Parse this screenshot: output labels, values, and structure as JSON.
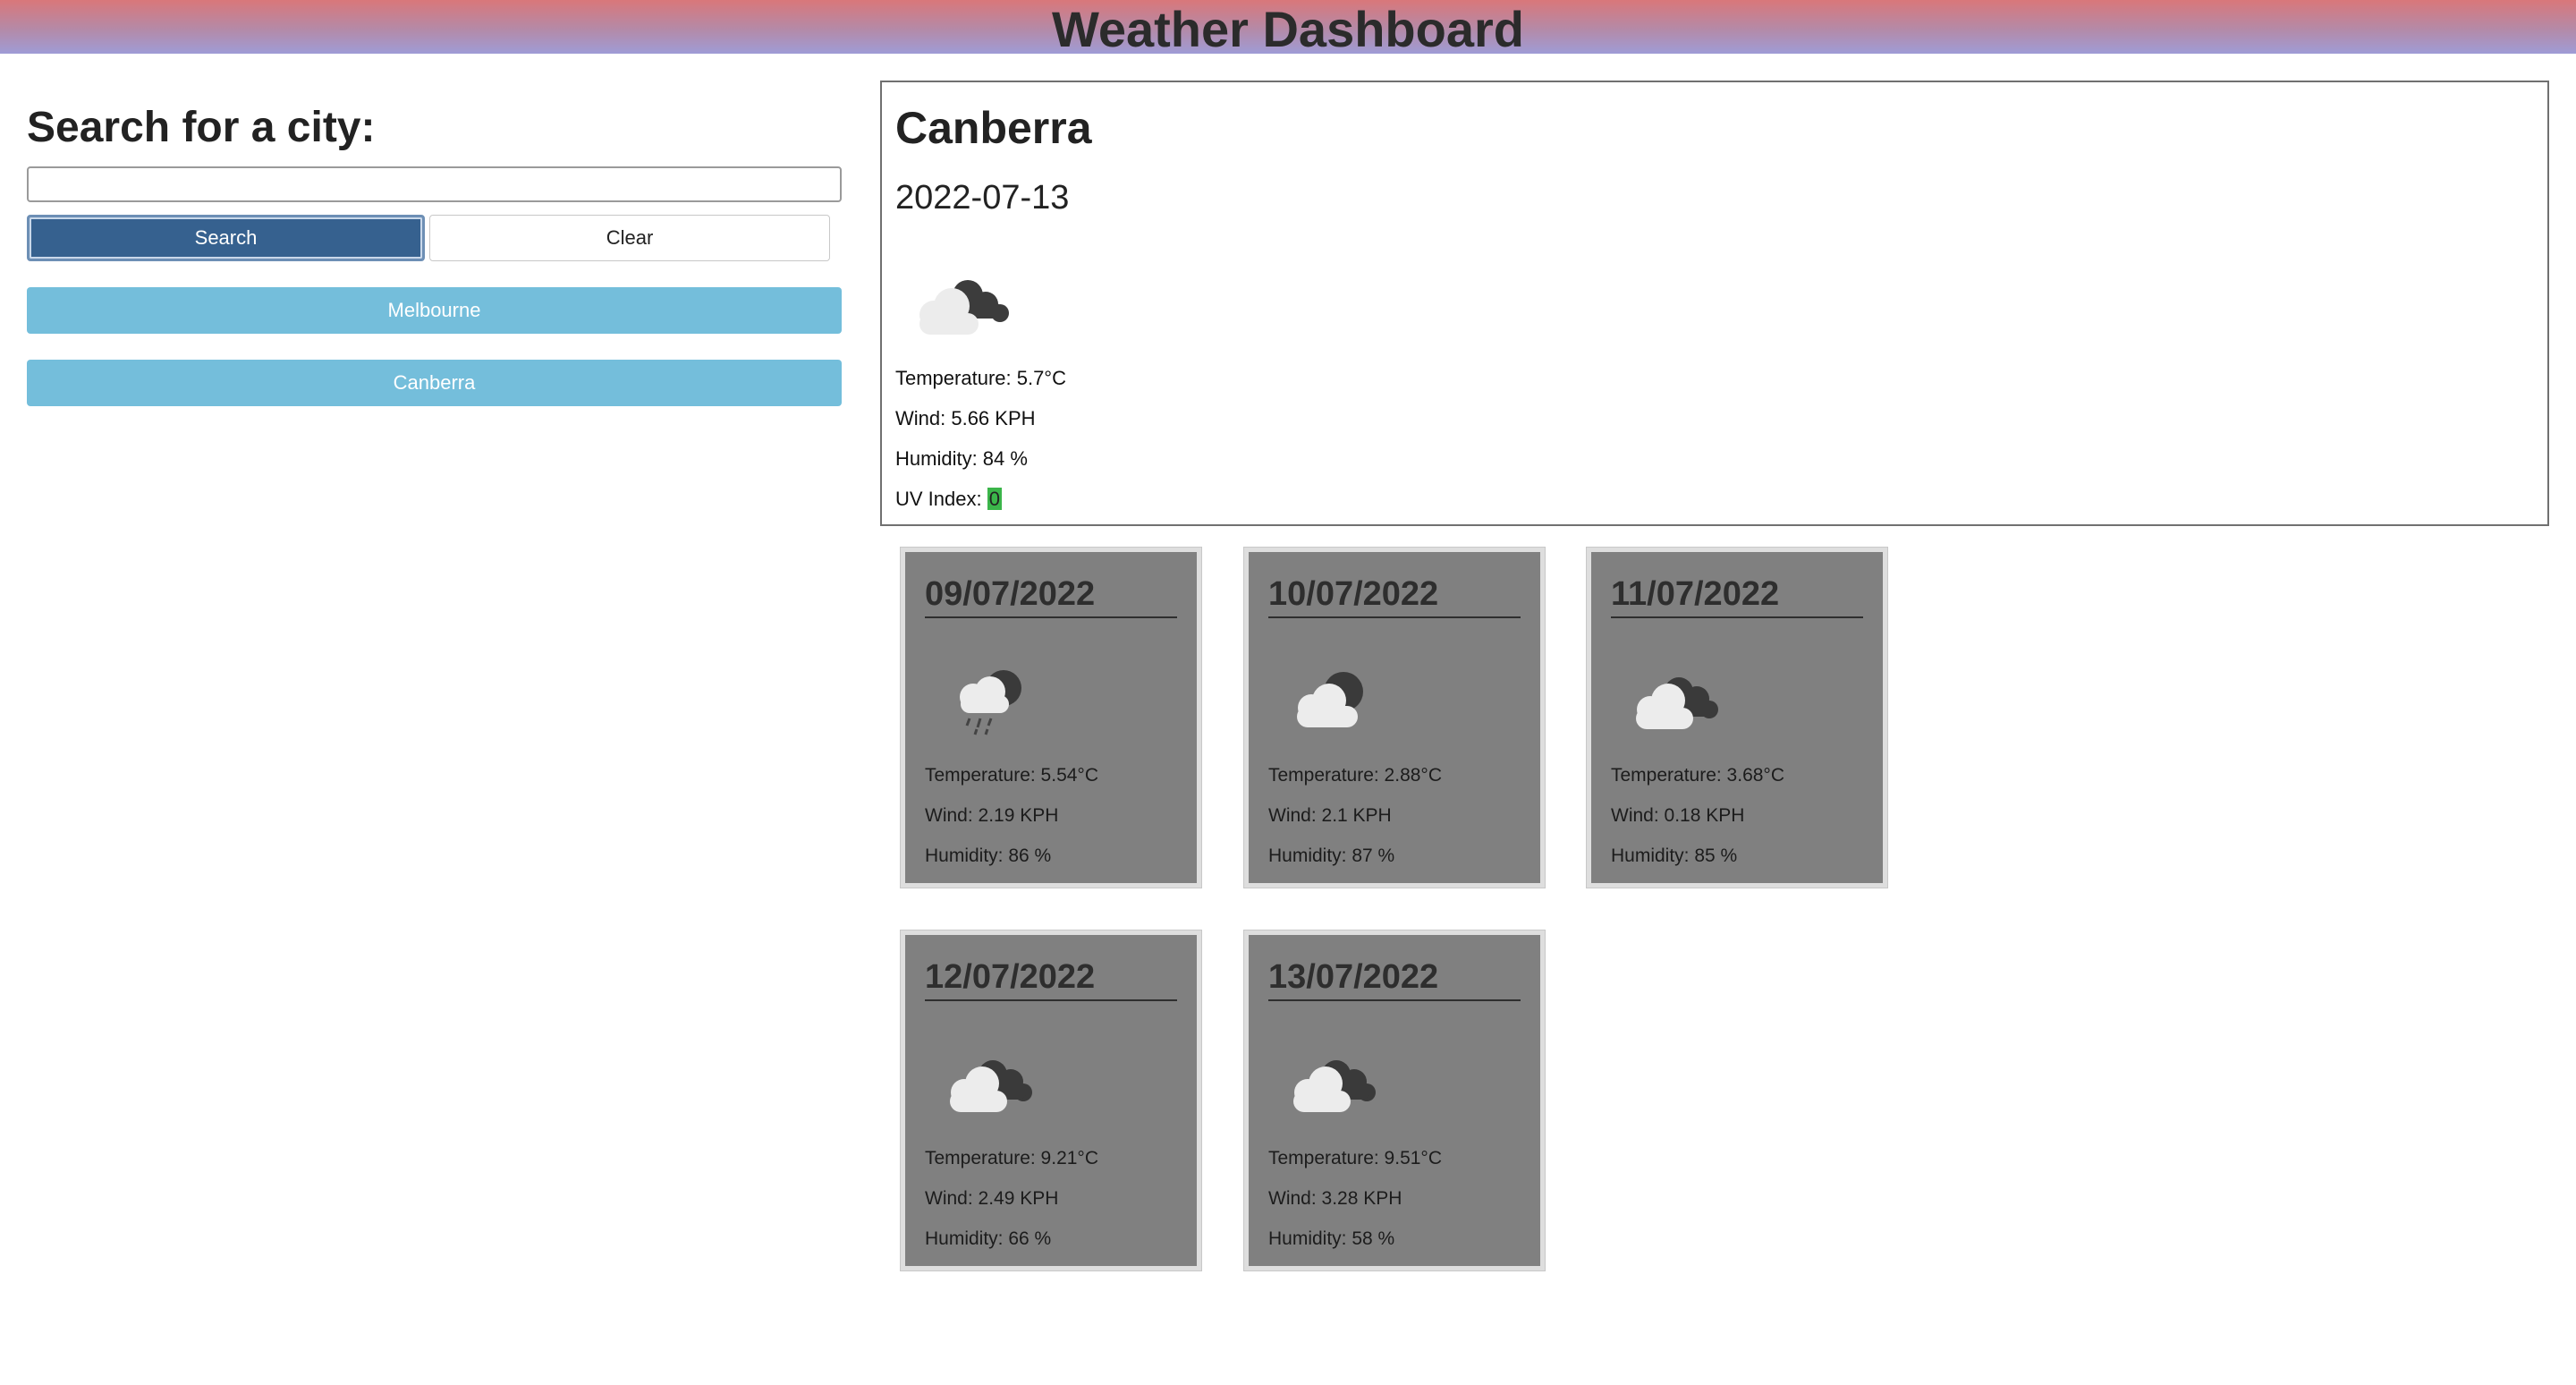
{
  "header": {
    "title": "Weather Dashboard"
  },
  "search": {
    "heading": "Search for a city:",
    "input_value": "",
    "search_label": "Search",
    "clear_label": "Clear",
    "history": [
      "Melbourne",
      "Canberra"
    ]
  },
  "current": {
    "city": "Canberra",
    "date": "2022-07-13",
    "icon": "partly-cloudy-icon",
    "temperature": "Temperature: 5.7°C",
    "wind": "Wind: 5.66 KPH",
    "humidity": "Humidity: 84 %",
    "uv_label": "UV Index: ",
    "uv_value": "0",
    "uv_color": "#3bb54a"
  },
  "forecast": [
    {
      "date": "09/07/2022",
      "icon": "rain-night-icon",
      "temperature": "Temperature: 5.54°C",
      "wind": "Wind: 2.19 KPH",
      "humidity": "Humidity: 86 %"
    },
    {
      "date": "10/07/2022",
      "icon": "cloud-night-icon",
      "temperature": "Temperature: 2.88°C",
      "wind": "Wind: 2.1 KPH",
      "humidity": "Humidity: 87 %"
    },
    {
      "date": "11/07/2022",
      "icon": "broken-clouds-icon",
      "temperature": "Temperature: 3.68°C",
      "wind": "Wind: 0.18 KPH",
      "humidity": "Humidity: 85 %"
    },
    {
      "date": "12/07/2022",
      "icon": "broken-clouds-icon",
      "temperature": "Temperature: 9.21°C",
      "wind": "Wind: 2.49 KPH",
      "humidity": "Humidity: 66 %"
    },
    {
      "date": "13/07/2022",
      "icon": "broken-clouds-icon",
      "temperature": "Temperature: 9.51°C",
      "wind": "Wind: 3.28 KPH",
      "humidity": "Humidity: 58 %"
    }
  ]
}
